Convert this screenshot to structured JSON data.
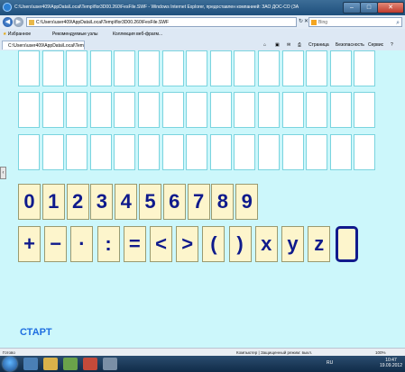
{
  "window": {
    "title": "C:\\Users\\user409\\AppData\\Local\\Temp\\flor3D00.260\\FesFile.SWF - Windows Internet Explorer, предоставлен компанией: ЗАО ДОС-СО (ЗА"
  },
  "addressbar": {
    "url": "C:\\Users\\user409\\AppData\\Local\\Temp\\flor3D00.260\\FesFile.SWF",
    "search_placeholder": "Bing"
  },
  "favorites": {
    "label": "Избранное",
    "items": [
      "Рекомендуемые узлы",
      "Коллекция веб-фрагм..."
    ]
  },
  "tabs": {
    "active_tab": "C:\\Users\\user409\\AppData\\Local\\Temp\\flor3D00...",
    "commands": [
      "Страница",
      "Безопасность",
      "Сервис"
    ]
  },
  "keyboard": {
    "digits": [
      "0",
      "1",
      "2",
      "3",
      "4",
      "5",
      "6",
      "7",
      "8",
      "9"
    ],
    "symbols": [
      "+",
      "−",
      "·",
      ":",
      "=",
      "<",
      ">",
      "(",
      ")",
      "x",
      "y",
      "z"
    ]
  },
  "start_label": "СТАРТ",
  "statusbar": {
    "left": "Готово",
    "middle": "Компьютер | Защищенный режим: выкл.",
    "zoom": "100%"
  },
  "taskbar": {
    "lang": "RU",
    "time": "10:47",
    "date": "19.09.2012"
  },
  "colors": {
    "content_bg": "#ccf7fb",
    "tile_bg": "#fdf5cc",
    "tile_text": "#0f1a8c",
    "start_text": "#1f6fe0",
    "cell_border": "#7ad4df"
  }
}
